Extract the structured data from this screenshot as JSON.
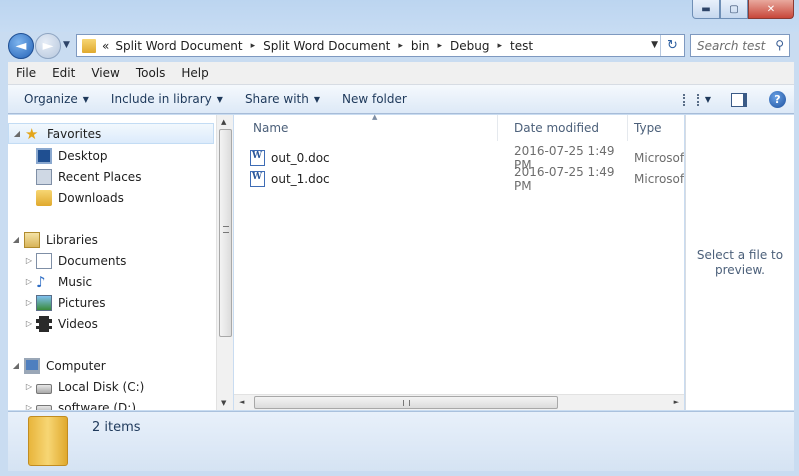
{
  "window": {
    "minimize_glyph": "▬",
    "maximize_glyph": "▢",
    "close_glyph": "✕"
  },
  "nav": {
    "back_glyph": "◄",
    "forward_glyph": "►"
  },
  "address": {
    "overflow": "«",
    "crumbs": [
      "Split Word Document",
      "Split Word Document",
      "bin",
      "Debug",
      "test"
    ],
    "separator": "▸",
    "refresh_glyph": "↻"
  },
  "search": {
    "placeholder": "Search test"
  },
  "menu": [
    "File",
    "Edit",
    "View",
    "Tools",
    "Help"
  ],
  "toolbar": {
    "organize": "Organize",
    "include_in_library": "Include in library",
    "share_with": "Share with",
    "new_folder": "New folder",
    "help": "?"
  },
  "navpane": {
    "items": [
      {
        "label": "Favorites",
        "icon": "star-icon"
      },
      {
        "label": "Desktop",
        "icon": "desktop-icon"
      },
      {
        "label": "Recent Places",
        "icon": "recent-places-icon"
      },
      {
        "label": "Downloads",
        "icon": "downloads-folder-icon"
      },
      {
        "label": "Libraries",
        "icon": "libraries-icon"
      },
      {
        "label": "Documents",
        "icon": "documents-icon"
      },
      {
        "label": "Music",
        "icon": "music-note-icon"
      },
      {
        "label": "Pictures",
        "icon": "pictures-icon"
      },
      {
        "label": "Videos",
        "icon": "videos-film-icon"
      },
      {
        "label": "Computer",
        "icon": "computer-icon"
      },
      {
        "label": "Local Disk (C:)",
        "icon": "drive-icon"
      },
      {
        "label": "software (D:)",
        "icon": "drive-icon"
      }
    ]
  },
  "columns": {
    "name": "Name",
    "date_modified": "Date modified",
    "type": "Type"
  },
  "files": [
    {
      "name": "out_0.doc",
      "date": "2016-07-25 1:49 PM",
      "type": "Microsoft"
    },
    {
      "name": "out_1.doc",
      "date": "2016-07-25 1:49 PM",
      "type": "Microsoft"
    }
  ],
  "preview": {
    "message": "Select a file to preview."
  },
  "status": {
    "count": "2 items"
  }
}
